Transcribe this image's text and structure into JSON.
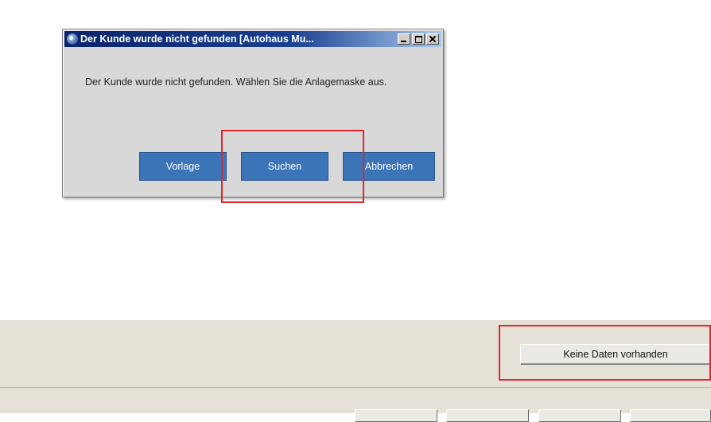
{
  "dialog": {
    "title": "Der Kunde wurde nicht gefunden [Autohaus Mu...",
    "message": "Der Kunde wurde nicht gefunden. Wählen Sie die Anlagemaske aus.",
    "buttons": {
      "vorlage": "Vorlage",
      "suchen": "Suchen",
      "abbrechen": "Abbrechen"
    }
  },
  "panel": {
    "status_button": "Keine Daten vorhanden"
  },
  "colors": {
    "highlight": "#e0262e",
    "dialog_button": "#3c74b8",
    "titlebar": "#0a246a"
  }
}
